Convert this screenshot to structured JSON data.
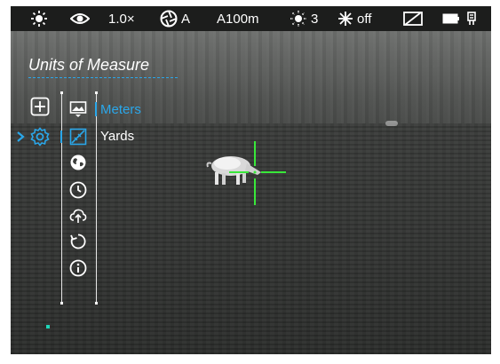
{
  "status_bar": {
    "zoom": "1.0×",
    "calibration_mode": "A",
    "calibration_distance": "A100m",
    "brightness_level": "3",
    "ir_state": "off",
    "icons": [
      "sun-icon",
      "eye-icon",
      "aperture-icon",
      "brightness-icon",
      "ir-illuminator-icon",
      "display-off-icon",
      "battery-icon",
      "external-power-icon"
    ]
  },
  "menu": {
    "title": "Units of Measure",
    "main_icons": [
      "plus-icon",
      "gear-icon"
    ],
    "sub_icons": [
      "image-icon",
      "ruler-icon",
      "globe-icon",
      "clock-icon",
      "cloud-upload-icon",
      "reset-icon",
      "info-icon"
    ],
    "options": [
      {
        "label": "Meters",
        "selected": true
      },
      {
        "label": "Yards",
        "selected": false
      }
    ]
  },
  "colors": {
    "accent": "#2aa7ea",
    "reticle": "#39e83a",
    "bar": "#1c1d1c"
  }
}
